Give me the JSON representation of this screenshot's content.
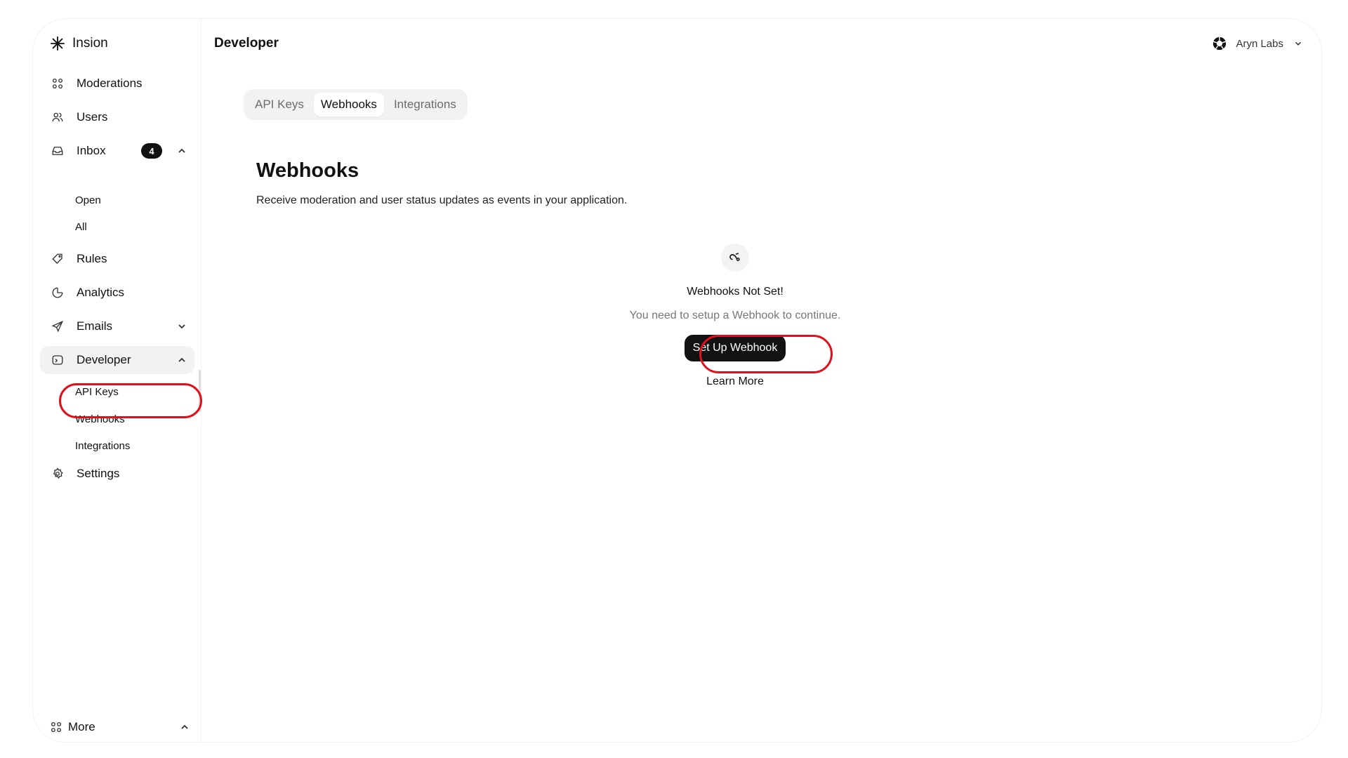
{
  "brand": {
    "name": "Insion",
    "icon": "asterisk-logo-icon"
  },
  "header": {
    "title": "Developer"
  },
  "account": {
    "name": "Aryn Labs",
    "icon": "aperture-logo-icon"
  },
  "sidebar": {
    "items": [
      {
        "label": "Moderations",
        "icon": "command-icon"
      },
      {
        "label": "Users",
        "icon": "users-icon"
      },
      {
        "label": "Inbox",
        "icon": "inbox-icon",
        "badge": "4"
      },
      {
        "label": "Rules",
        "icon": "tag-icon"
      },
      {
        "label": "Analytics",
        "icon": "pie-chart-icon"
      },
      {
        "label": "Emails",
        "icon": "send-icon"
      },
      {
        "label": "Developer",
        "icon": "terminal-icon"
      },
      {
        "label": "Settings",
        "icon": "gear-icon"
      }
    ],
    "inbox_sub": [
      "Open",
      "All"
    ],
    "developer_sub": [
      "API Keys",
      "Webhooks",
      "Integrations"
    ],
    "more_label": "More"
  },
  "tabs": [
    "API Keys",
    "Webhooks",
    "Integrations"
  ],
  "content": {
    "title": "Webhooks",
    "subtitle": "Receive moderation and user status updates as events in your application.",
    "empty_title": "Webhooks Not Set!",
    "empty_desc": "You need to setup a Webhook to continue.",
    "button_label": "Set Up Webhook",
    "learn_more": "Learn More"
  },
  "colors": {
    "highlight": "#e0101b",
    "button_bg": "#121212",
    "tabs_bg": "#f2f2f2"
  }
}
